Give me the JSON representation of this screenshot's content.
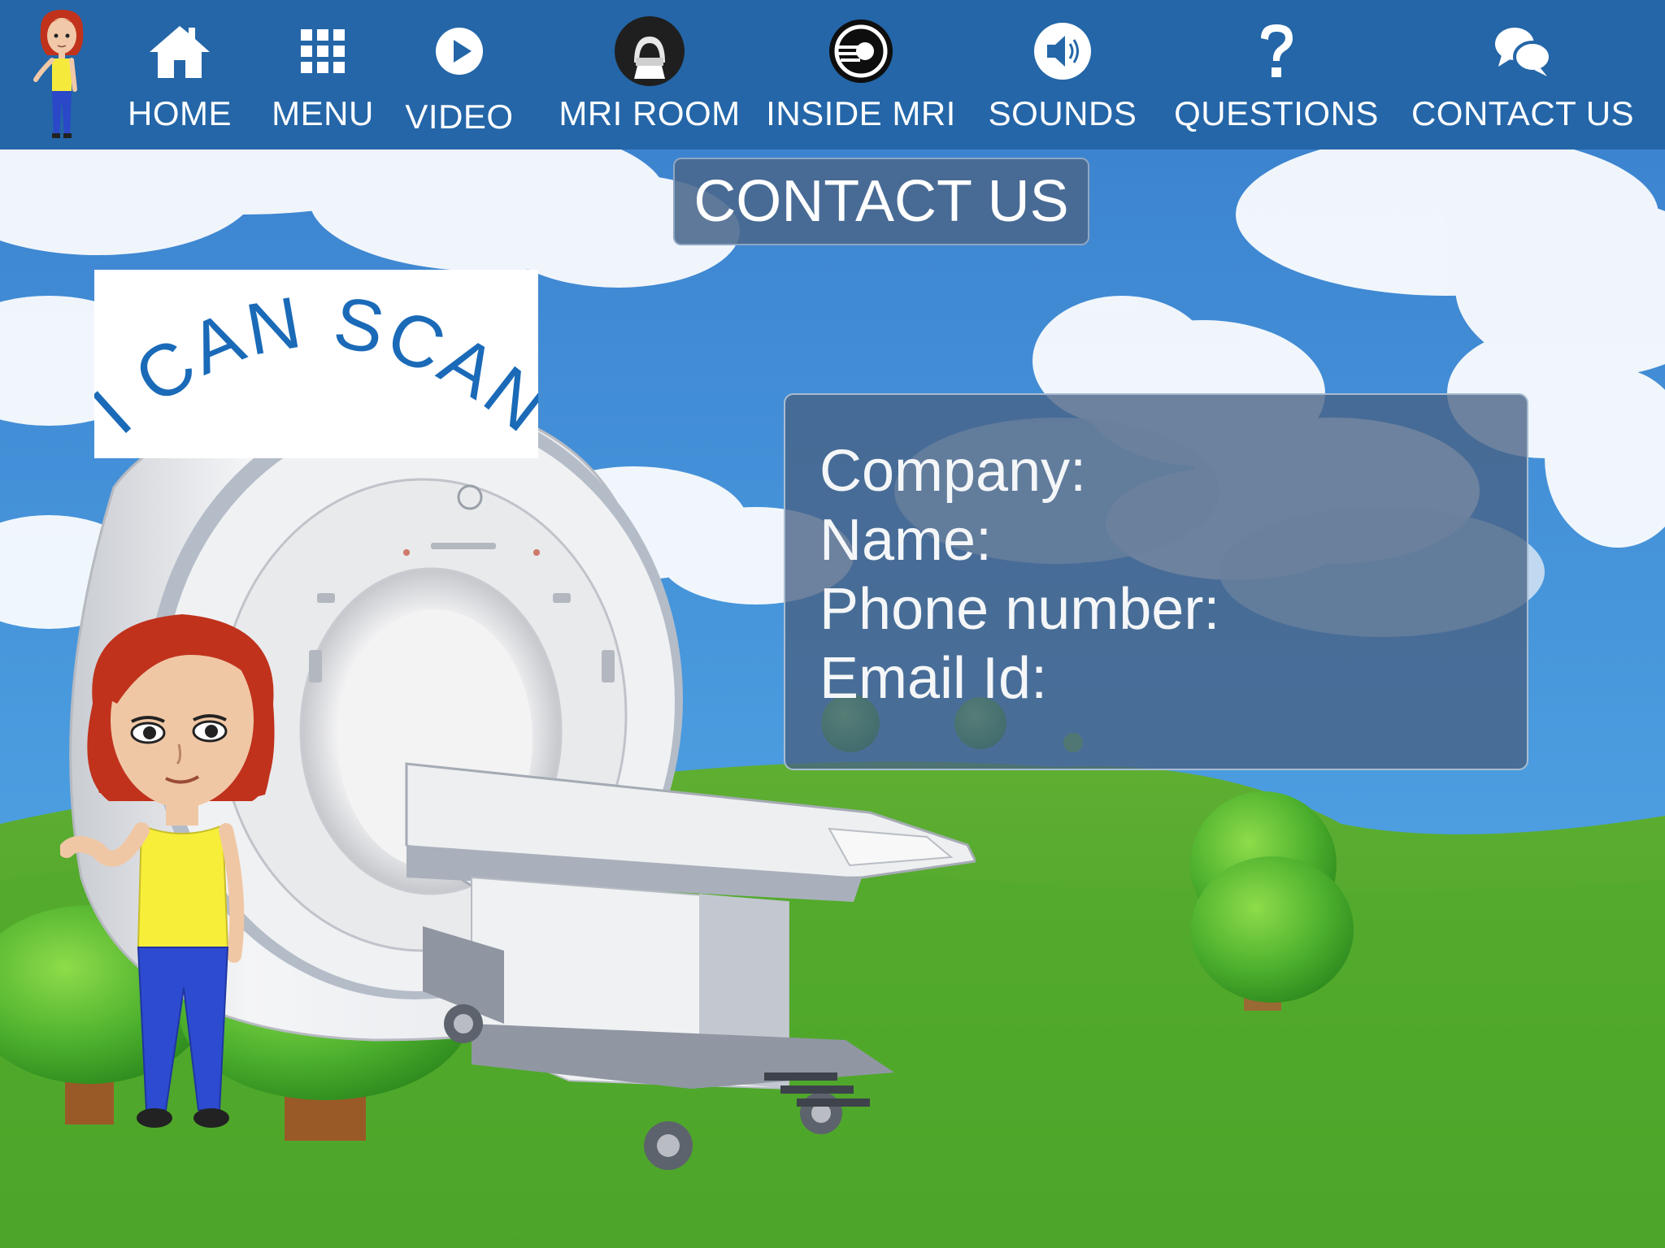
{
  "navbar": {
    "items": [
      {
        "id": "home",
        "label": "HOME",
        "icon": "home-icon"
      },
      {
        "id": "menu",
        "label": "MENU",
        "icon": "grid-icon"
      },
      {
        "id": "video",
        "label": "VIDEO",
        "icon": "play-icon"
      },
      {
        "id": "mri-room",
        "label": "MRI ROOM",
        "icon": "mri-room-icon"
      },
      {
        "id": "inside-mri",
        "label": "INSIDE MRI",
        "icon": "inside-mri-icon"
      },
      {
        "id": "sounds",
        "label": "SOUNDS",
        "icon": "speaker-icon"
      },
      {
        "id": "questions",
        "label": "QUESTIONS",
        "icon": "question-icon"
      },
      {
        "id": "contact-us",
        "label": "CONTACT US",
        "icon": "chat-bubbles-icon"
      }
    ],
    "background_color": "#2466a8"
  },
  "page": {
    "title": "CONTACT US"
  },
  "logo": {
    "text": "I CAN SCAN",
    "color": "#1a6ab8"
  },
  "contact": {
    "company_label": "Company:",
    "name_label": "Name:",
    "phone_label": "Phone number:",
    "email_label": "Email Id:"
  }
}
